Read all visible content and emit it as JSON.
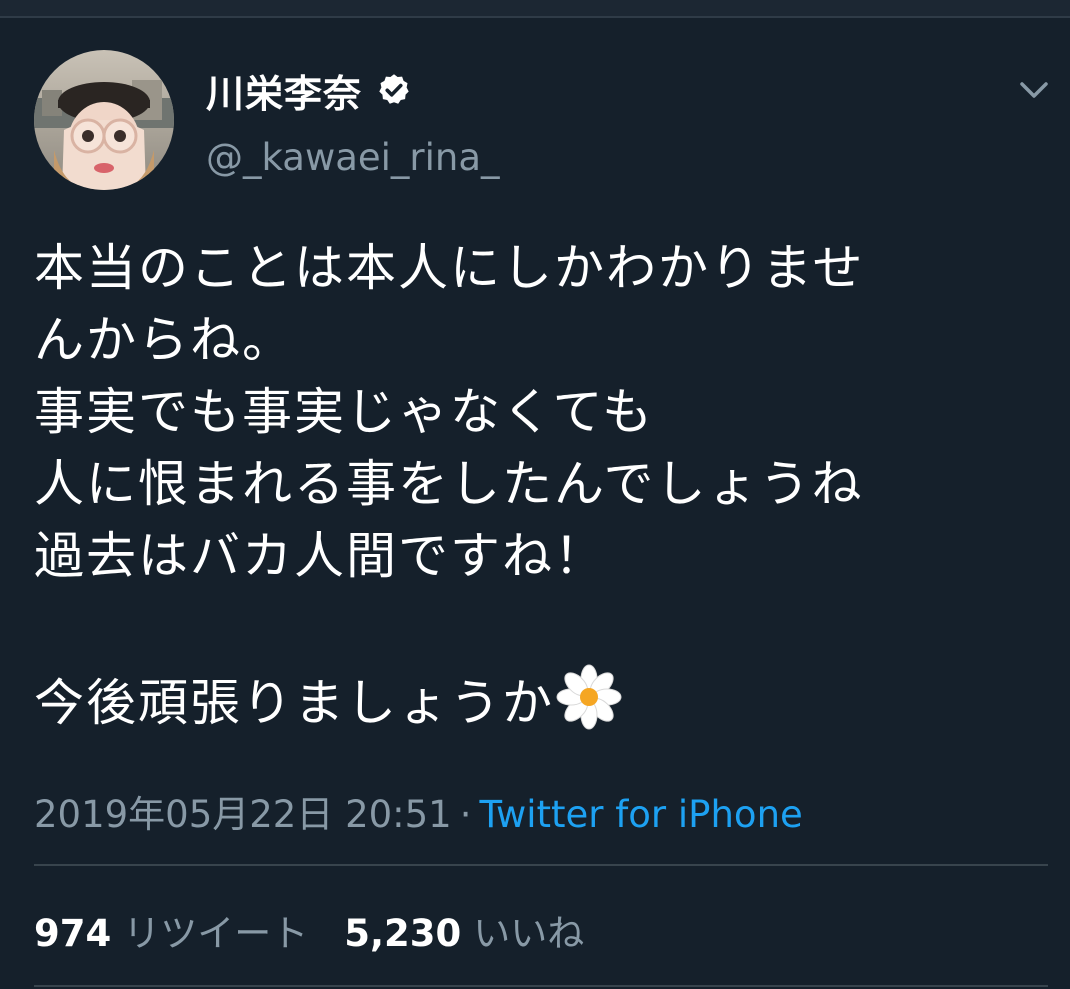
{
  "author": {
    "display_name": "川栄李奈",
    "handle": "@_kawaei_rina_",
    "verified": true
  },
  "tweet": {
    "lines": [
      "本当のことは本人にしかわかりませ",
      "んからね。",
      "事実でも事実じゃなくても",
      "人に恨まれる事をしたんでしょうね",
      "過去はバカ人間ですね！",
      "",
      "今後頑張りましょうか"
    ],
    "trailing_emoji": "blossom-icon"
  },
  "meta": {
    "timestamp": "2019年05月22日 20:51",
    "separator": "·",
    "source": "Twitter for iPhone"
  },
  "stats": {
    "retweets_count": "974",
    "retweets_label": "リツイート",
    "likes_count": "5,230",
    "likes_label": "いいね"
  },
  "colors": {
    "background": "#15202b",
    "text_primary": "#ffffff",
    "text_secondary": "#8899a6",
    "link": "#1da1f2",
    "divider": "#38444d"
  }
}
